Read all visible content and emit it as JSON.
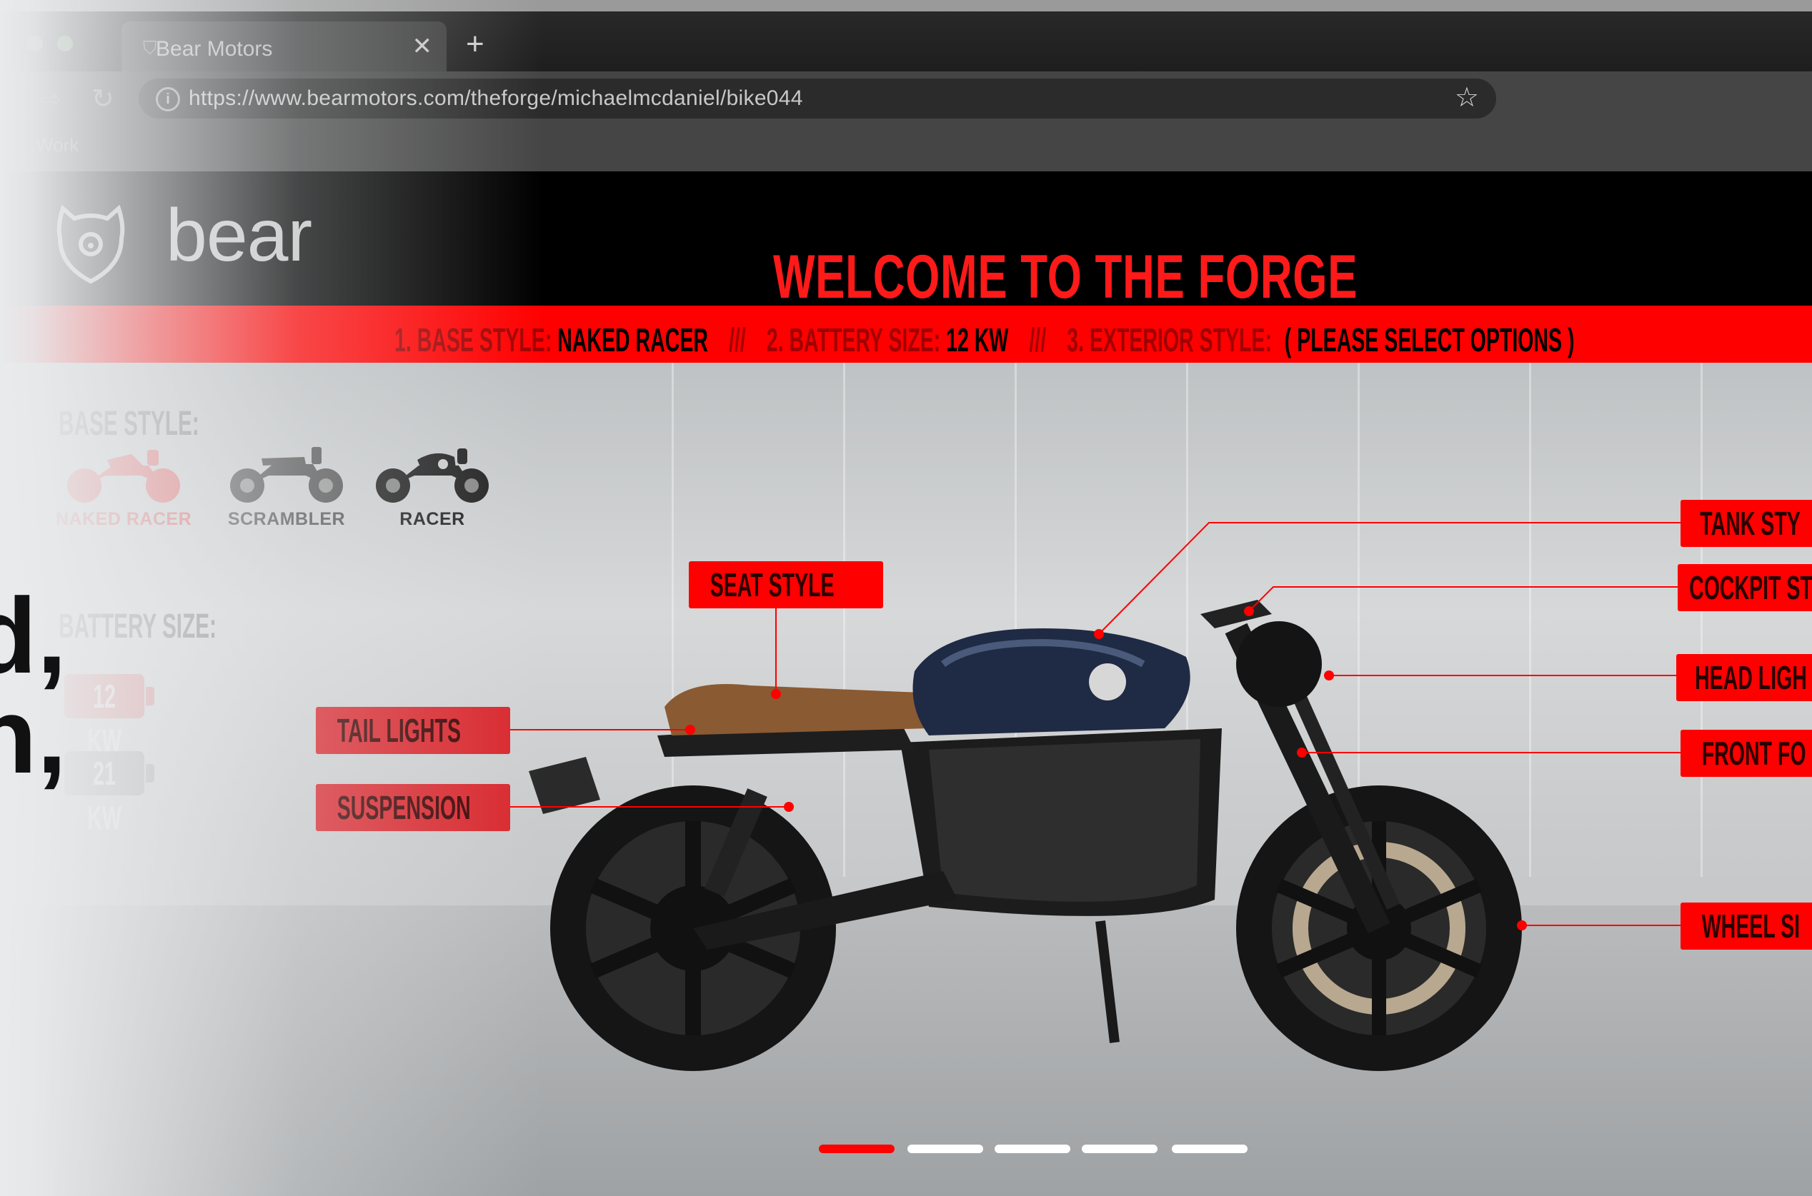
{
  "browser": {
    "tab_title": "Bear Motors",
    "tab_close": "✕",
    "new_tab": "+",
    "url": "https://www.bearmotors.com/theforge/michaelmcdaniel/bike044",
    "bookmark": "Work"
  },
  "site": {
    "logo_text": "bear",
    "welcome": "WELCOME TO THE FORGE",
    "steps": [
      {
        "label": "1. BASE STYLE:",
        "value": "NAKED RACER"
      },
      {
        "label": "2. BATTERY SIZE:",
        "value": "12 KW"
      },
      {
        "label": "3. EXTERIOR STYLE:",
        "value": "( PLEASE SELECT OPTIONS )"
      }
    ],
    "separator": "///"
  },
  "panel": {
    "base_title": "BASE STYLE:",
    "styles": [
      {
        "label": "NAKED RACER",
        "color": "#e84a4a",
        "selected": true
      },
      {
        "label": "SCRAMBLER",
        "color": "#555555",
        "selected": false
      },
      {
        "label": "RACER",
        "color": "#222222",
        "selected": false
      }
    ],
    "battery_title": "BATTERY SIZE:",
    "batteries": [
      {
        "label": "12 KW",
        "color": "#e35d5d",
        "selected": true
      },
      {
        "label": "21 KW",
        "color": "#8e8e8e",
        "selected": false
      }
    ]
  },
  "left_text": {
    "line1": "d,",
    "line2": "n,"
  },
  "callouts": {
    "seat": "SEAT STYLE",
    "tail": "TAIL LIGHTS",
    "suspension": "SUSPENSION",
    "tank": "TANK STY",
    "cockpit": "COCKPIT ST",
    "headlight": "HEAD LIGH",
    "frontfork": "FRONT FO",
    "wheel": "WHEEL SI"
  },
  "pager": {
    "count": 5,
    "active": 0
  },
  "colors": {
    "accent": "#ff0000",
    "header_bg": "#000000"
  }
}
